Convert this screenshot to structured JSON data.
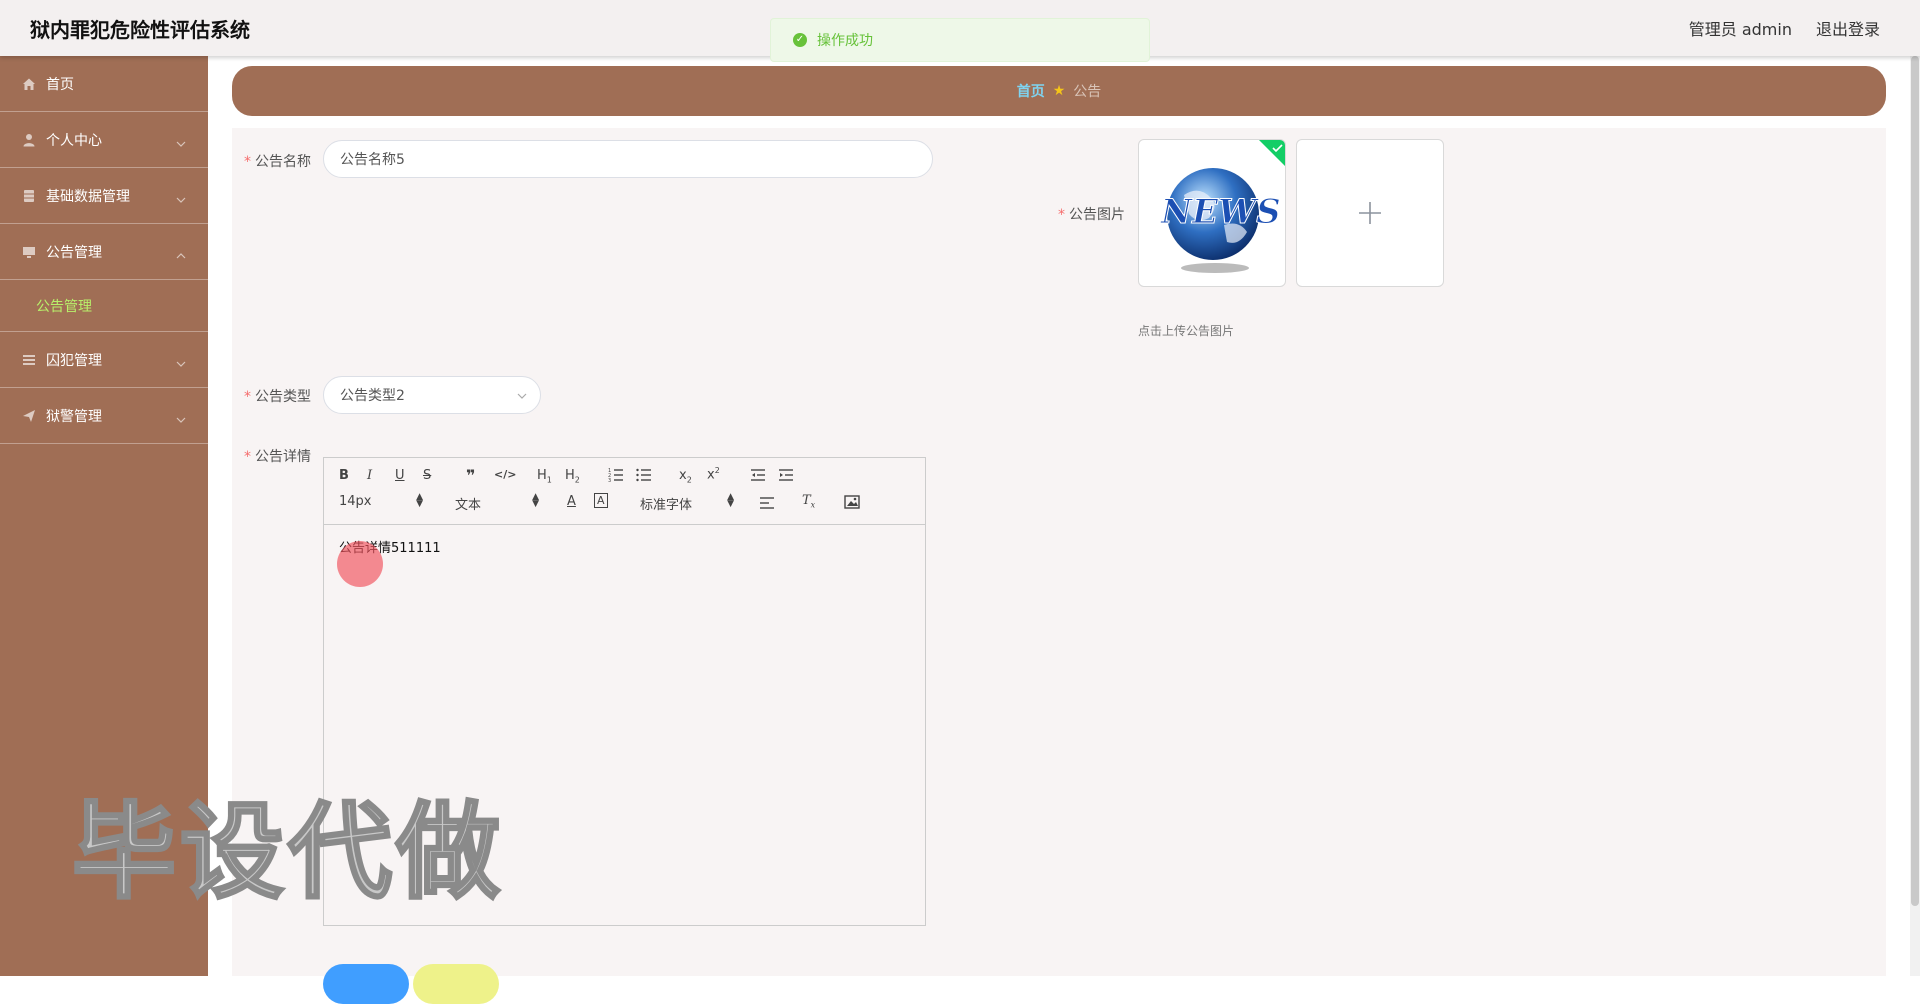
{
  "header": {
    "title": "狱内罪犯危险性评估系统",
    "user_label": "管理员 admin",
    "logout_label": "退出登录"
  },
  "toast": {
    "message": "操作成功"
  },
  "sidebar": {
    "items": [
      {
        "label": "首页",
        "icon": "home-icon"
      },
      {
        "label": "个人中心",
        "icon": "user-icon"
      },
      {
        "label": "基础数据管理",
        "icon": "database-icon"
      },
      {
        "label": "公告管理",
        "icon": "monitor-icon"
      },
      {
        "label": "囚犯管理",
        "icon": "list-icon"
      },
      {
        "label": "狱警管理",
        "icon": "send-icon"
      }
    ],
    "subitem": {
      "label": "公告管理",
      "color": "#b8f06a"
    }
  },
  "breadcrumb": {
    "home": "首页",
    "current": "公告"
  },
  "form": {
    "name_label": "公告名称",
    "name_value": "公告名称5",
    "image_label": "公告图片",
    "image_tip": "点击上传公告图片",
    "image_text": "NEWS",
    "type_label": "公告类型",
    "type_value": "公告类型2",
    "detail_label": "公告详情",
    "detail_content": "公告详情511111"
  },
  "editor": {
    "font_size": "14px",
    "paragraph": "文本",
    "font_family": "标准字体"
  },
  "watermark": "毕设代做",
  "colors": {
    "sidebar_bg": "#a06e55",
    "breadcrumb_bg": "#a06e55",
    "required_star": "#f56c6c",
    "submit_button": "#409eff",
    "reset_button": "#eef28a",
    "success": "#67c23a"
  }
}
